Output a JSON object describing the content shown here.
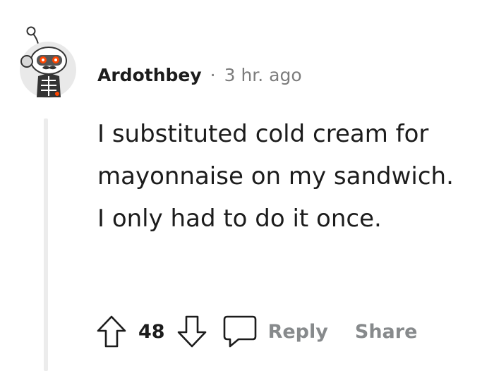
{
  "comment": {
    "username": "Ardothbey",
    "separator": "·",
    "timestamp": "3 hr. ago",
    "body": "I substituted cold cream for mayonnaise on my sandwich. I only had to do it once.",
    "score": "48",
    "reply_label": "Reply",
    "share_label": "Share"
  },
  "icons": {
    "avatar": "snoo-avatar-icon",
    "upvote": "upvote-arrow-icon",
    "downvote": "downvote-arrow-icon",
    "reply": "comment-bubble-icon"
  },
  "colors": {
    "text": "#1c1c1c",
    "muted": "#7c7c7c",
    "action": "#878a8c",
    "thread_line": "#ececec",
    "avatar_accent": "#ff4500"
  }
}
